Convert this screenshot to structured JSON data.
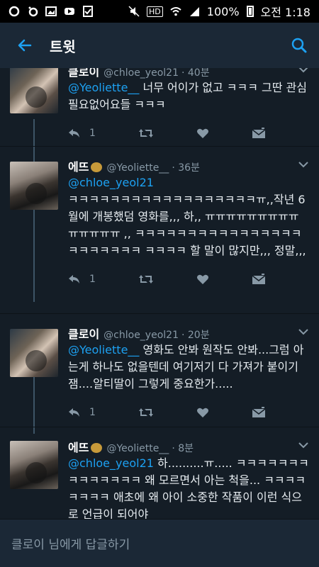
{
  "status_bar": {
    "time": "오전 1:18",
    "battery": "100%",
    "hd_label": "HD"
  },
  "appbar": {
    "title": "트윗"
  },
  "tweets": [
    {
      "name": "클로이",
      "handle": "@chloe_yeol21",
      "time": "· 40분",
      "mention": "@Yeoliette__",
      "text": " 너무 어이가 없고 ㅋㅋㅋ 그딴 관심 필요없어요들 ㅋㅋㅋ",
      "reply_count": "1"
    },
    {
      "name": "에뜨",
      "handle": "@Yeoliette__",
      "time": "· 36분",
      "mention": "@chloe_yeol21",
      "text": "ㅋㅋㅋㅋㅋㅋㅋㅋㅋㅋㅋㅋㅋㅋㅋㅋㅋㅋㅠ,,작년 6월에 개봉했덤 영화를,,, 하,, ㅠㅠㅠㅠㅠㅠㅠㅠㅠㅠㅠㅠㅠㅠ ,, ㅋㅋㅋㅋㅋㅋㅋㅋㅋㅋㅋㅋㅋㅋㅋㅋㅋㅋㅋㅋㅋㅋㅋ ㅋㅋㅋㅋ 할 말이 많지만,,, 정말,,,",
      "reply_count": "1"
    },
    {
      "name": "클로이",
      "handle": "@chloe_yeol21",
      "time": "· 20분",
      "mention": "@Yeoliette__",
      "text": " 영화도 안봐 원작도 안봐...그럼 아는게 하나도 없을텐데 여기저기 다 가져가 붙이기 잼....알티딸이 그렇게 중요한가.....",
      "reply_count": "1"
    },
    {
      "name": "에뜨",
      "handle": "@Yeoliette__",
      "time": "· 8분",
      "mention": "@chloe_yeol21",
      "text": " 하..........ㅠ..... ㅋㅋㅋㅋㅋㅋㅋㅋㅋㅋㅋㅋㅋㅋ 왜 모르면서 아는 척을... ㅋㅋㅋㅋㅋㅋㅋㅋ 애초에 왜 아이 소중한 작품이 이런 식으로 언급이 되어야"
    }
  ],
  "reply_bar": {
    "placeholder": "클로이 님에게 답글하기"
  },
  "colors": {
    "background": "#141d26",
    "appbar": "#1b2836",
    "accent": "#1da1f2",
    "muted": "#8899a6"
  }
}
